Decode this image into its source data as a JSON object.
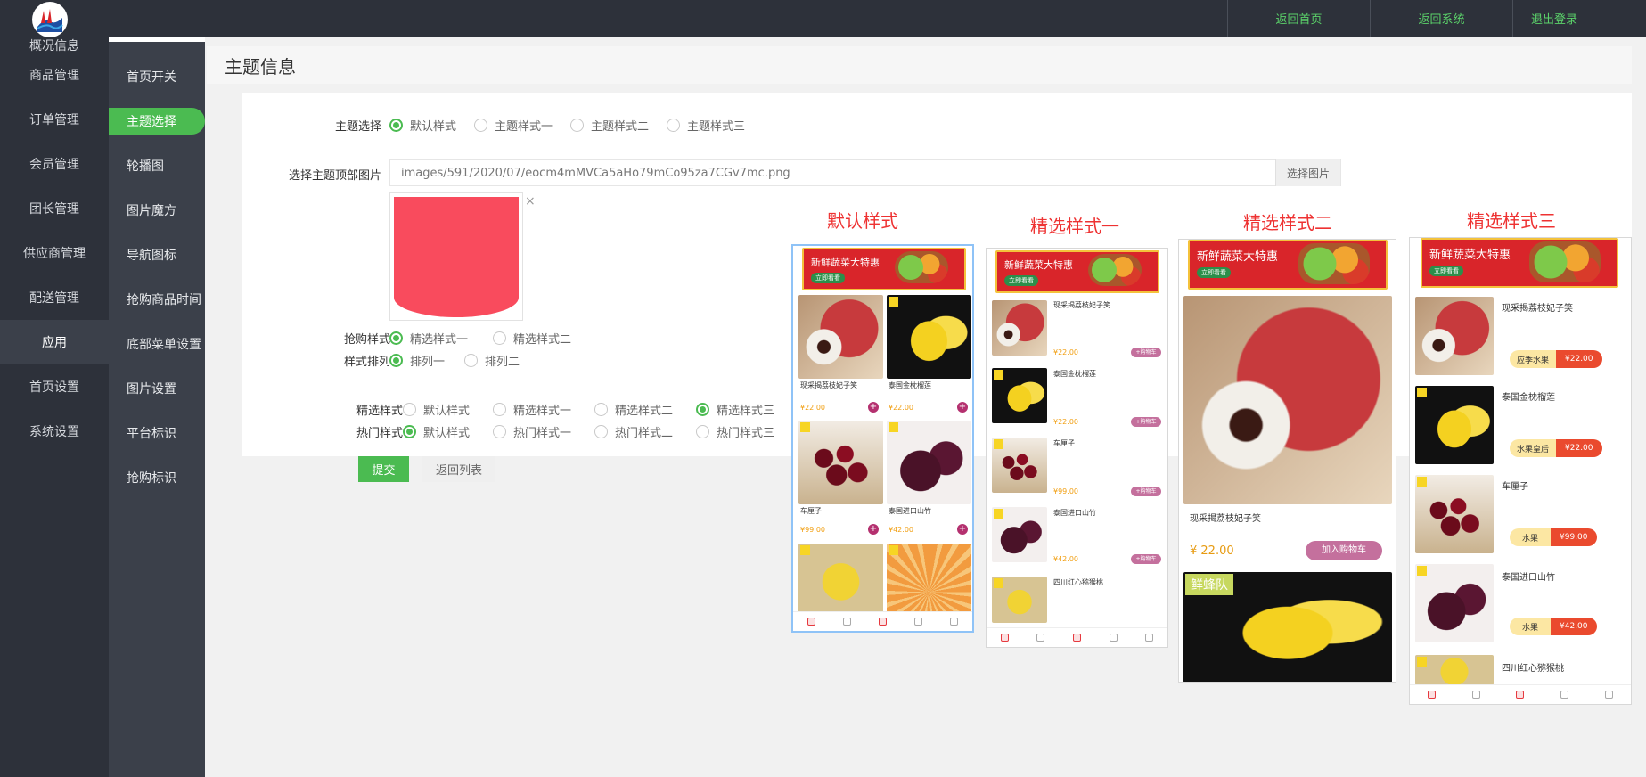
{
  "topbar": {
    "links": [
      "返回首页",
      "返回系统",
      "退出登录"
    ]
  },
  "sidebar_primary": [
    "概况信息",
    "商品管理",
    "订单管理",
    "会员管理",
    "团长管理",
    "供应商管理",
    "配送管理",
    "应用",
    "首页设置",
    "系统设置"
  ],
  "sidebar_secondary": [
    "首页开关",
    "主题选择",
    "轮播图",
    "图片魔方",
    "导航图标",
    "抢购商品时间",
    "底部菜单设置",
    "图片设置",
    "平台标识",
    "抢购标识"
  ],
  "page": {
    "title": "主题信息"
  },
  "form": {
    "theme_label": "主题选择",
    "theme_options": [
      "默认样式",
      "主题样式一",
      "主题样式二",
      "主题样式三"
    ],
    "theme_selected": 0,
    "header_img_label": "选择主题顶部图片",
    "header_img_value": "images/591/2020/07/eocm4mMVCa5aHo79mCo95za7CGv7mc.png",
    "choose_img_button": "选择图片",
    "close_mark": "×",
    "flash_label": "抢购样式",
    "flash_options": [
      "精选样式一",
      "精选样式二"
    ],
    "flash_selected": 0,
    "arrange_label": "样式排列",
    "arrange_options": [
      "排列一",
      "排列二"
    ],
    "arrange_selected": 0,
    "featured_label": "精选样式",
    "featured_options": [
      "默认样式",
      "精选样式一",
      "精选样式二",
      "精选样式三"
    ],
    "featured_selected": 3,
    "hot_label": "热门样式",
    "hot_options": [
      "默认样式",
      "热门样式一",
      "热门样式二",
      "热门样式三"
    ],
    "hot_selected": 0,
    "submit_button": "提交",
    "back_button": "返回列表"
  },
  "previews": {
    "titles": [
      "默认样式",
      "精选样式一",
      "精选样式二",
      "精选样式三"
    ],
    "banner_title": "新鲜蔬菜大特惠",
    "banner_sub": "立即看看",
    "products": [
      {
        "name": "现采揭荔枝妃子笑",
        "price": "¥22.00"
      },
      {
        "name": "泰国金枕榴莲",
        "price": "¥22.00"
      },
      {
        "name": "车厘子",
        "price": "¥99.00"
      },
      {
        "name": "泰国进口山竹",
        "price": "¥42.00"
      },
      {
        "name": "四川红心猕猴桃",
        "price": ""
      }
    ],
    "big_name": "现采揭荔枝妃子笑",
    "big_price": "¥ 22.00",
    "add_cart": "加入购物车",
    "small_cart": "+购物车",
    "brand": "鲜蜂队",
    "style3_tags": [
      "应季水果",
      "水果皇后",
      "水果",
      "水果"
    ],
    "style3_prices": [
      "¥22.00",
      "¥22.00",
      "¥99.00",
      "¥42.00"
    ],
    "accent": "#4bbb51",
    "title_color": "#ee3232"
  }
}
